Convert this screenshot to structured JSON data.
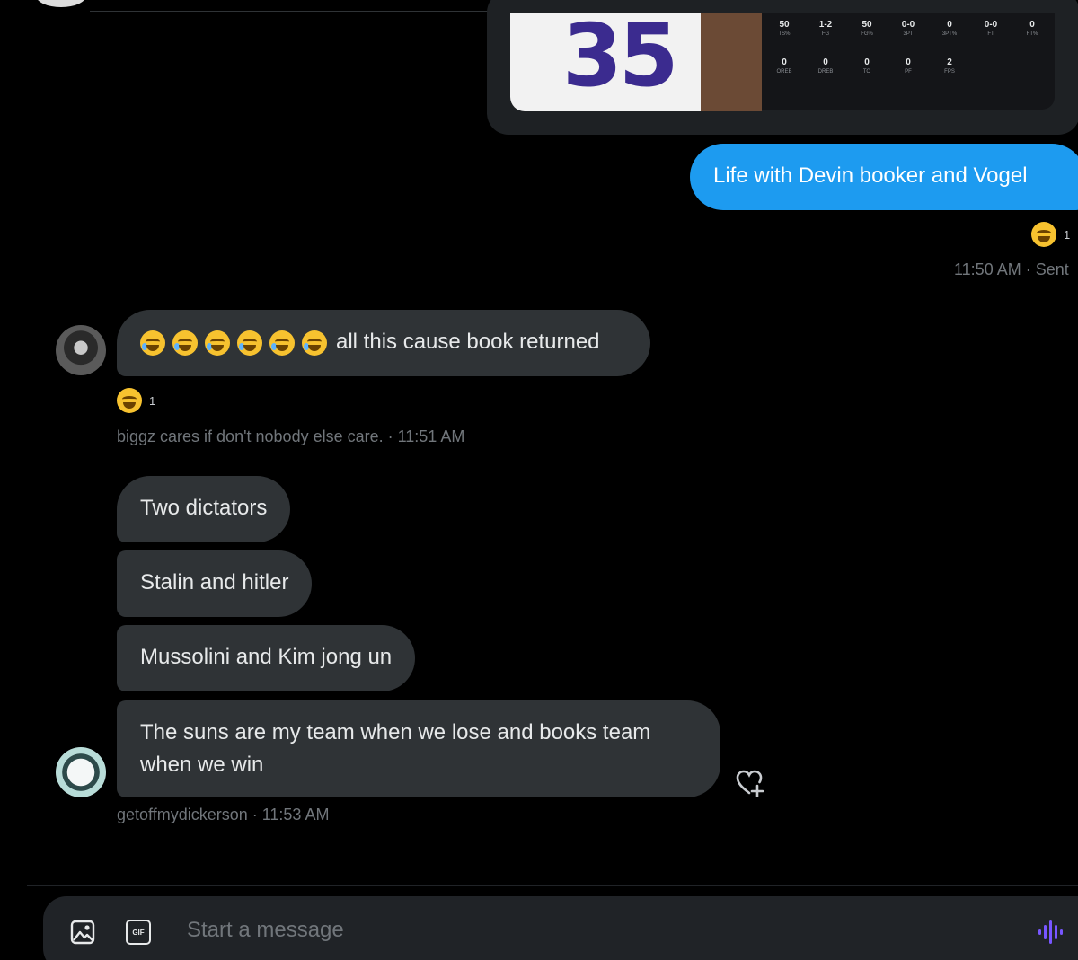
{
  "shared_card": {
    "jersey_number": "35",
    "stats_row1": [
      {
        "value": "50",
        "label": "TS%"
      },
      {
        "value": "1-2",
        "label": "FG"
      },
      {
        "value": "50",
        "label": "FG%"
      },
      {
        "value": "0-0",
        "label": "3PT"
      },
      {
        "value": "0",
        "label": "3PT%"
      },
      {
        "value": "0-0",
        "label": "FT"
      },
      {
        "value": "0",
        "label": "FT%"
      }
    ],
    "stats_row2": [
      {
        "value": "0",
        "label": "OREB"
      },
      {
        "value": "0",
        "label": "DREB"
      },
      {
        "value": "0",
        "label": "TO"
      },
      {
        "value": "0",
        "label": "PF"
      },
      {
        "value": "2",
        "label": "FPS"
      }
    ]
  },
  "messages": {
    "sent_1": {
      "text": "Life with Devin booker and Vogel",
      "reaction_count": "1",
      "meta": "11:50 AM · Sent"
    },
    "received_1": {
      "emoji_prefix_count": 6,
      "text": "all this cause book returned",
      "reaction_count": "1",
      "meta": "biggz cares if don't nobody else care. · 11:51 AM"
    },
    "received_2": "Two dictators",
    "received_3": "Stalin and hitler",
    "received_4": "Mussolini and Kim jong un",
    "received_5": {
      "line1": "The suns are my team when we lose and books team",
      "line2": "when we win",
      "meta": "getoffmydickerson · 11:53 AM"
    }
  },
  "composer": {
    "placeholder": "Start a message",
    "gif_label": "GIF",
    "icons": [
      "image-icon",
      "gif-icon",
      "voice-icon"
    ]
  },
  "colors": {
    "accent": "#1d9bf0",
    "incoming_bubble": "#2f3336",
    "background": "#000000",
    "voice_icon": "#7856ff"
  }
}
